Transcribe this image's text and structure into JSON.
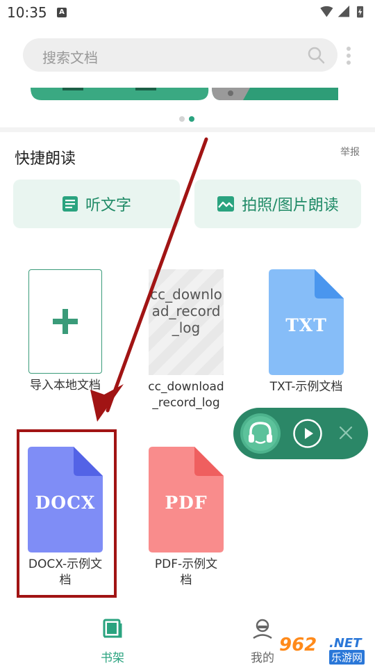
{
  "status": {
    "time": "10:35",
    "notification_glyph": "A"
  },
  "search": {
    "placeholder": "搜索文档"
  },
  "section": {
    "title": "快捷朗读",
    "report": "举报"
  },
  "quick_actions": [
    {
      "label": "听文字",
      "icon": "document-lines-icon"
    },
    {
      "label": "拍照/图片朗读",
      "icon": "image-icon"
    }
  ],
  "books": [
    {
      "title": "导入本地文档",
      "type": "add"
    },
    {
      "title_line1": "cc_download",
      "title_line2": "_record_log",
      "thumb_text": "cc_download_record_log",
      "type": "thumb"
    },
    {
      "title": "TXT-示例文档",
      "label": "TXT",
      "color": "#86bdf8",
      "fold": "#4a96ee"
    },
    {
      "title_line1": "DOCX-示例文",
      "title_line2": "档",
      "label": "DOCX",
      "color": "#7f8df6",
      "fold": "#5363e6"
    },
    {
      "title_line1": "PDF-示例文",
      "title_line2": "档",
      "label": "PDF",
      "color": "#f98c8c",
      "fold": "#ef5f5f"
    }
  ],
  "player": {
    "bg": "#2b8767"
  },
  "tabs": [
    {
      "label": "书架",
      "active": true
    },
    {
      "label": "我的",
      "active": false
    }
  ],
  "watermark": {
    "num": "962",
    "net": ".NET",
    "cn": "乐游网"
  },
  "colors": {
    "accent": "#2aa37f",
    "annotation": "#a11414"
  }
}
